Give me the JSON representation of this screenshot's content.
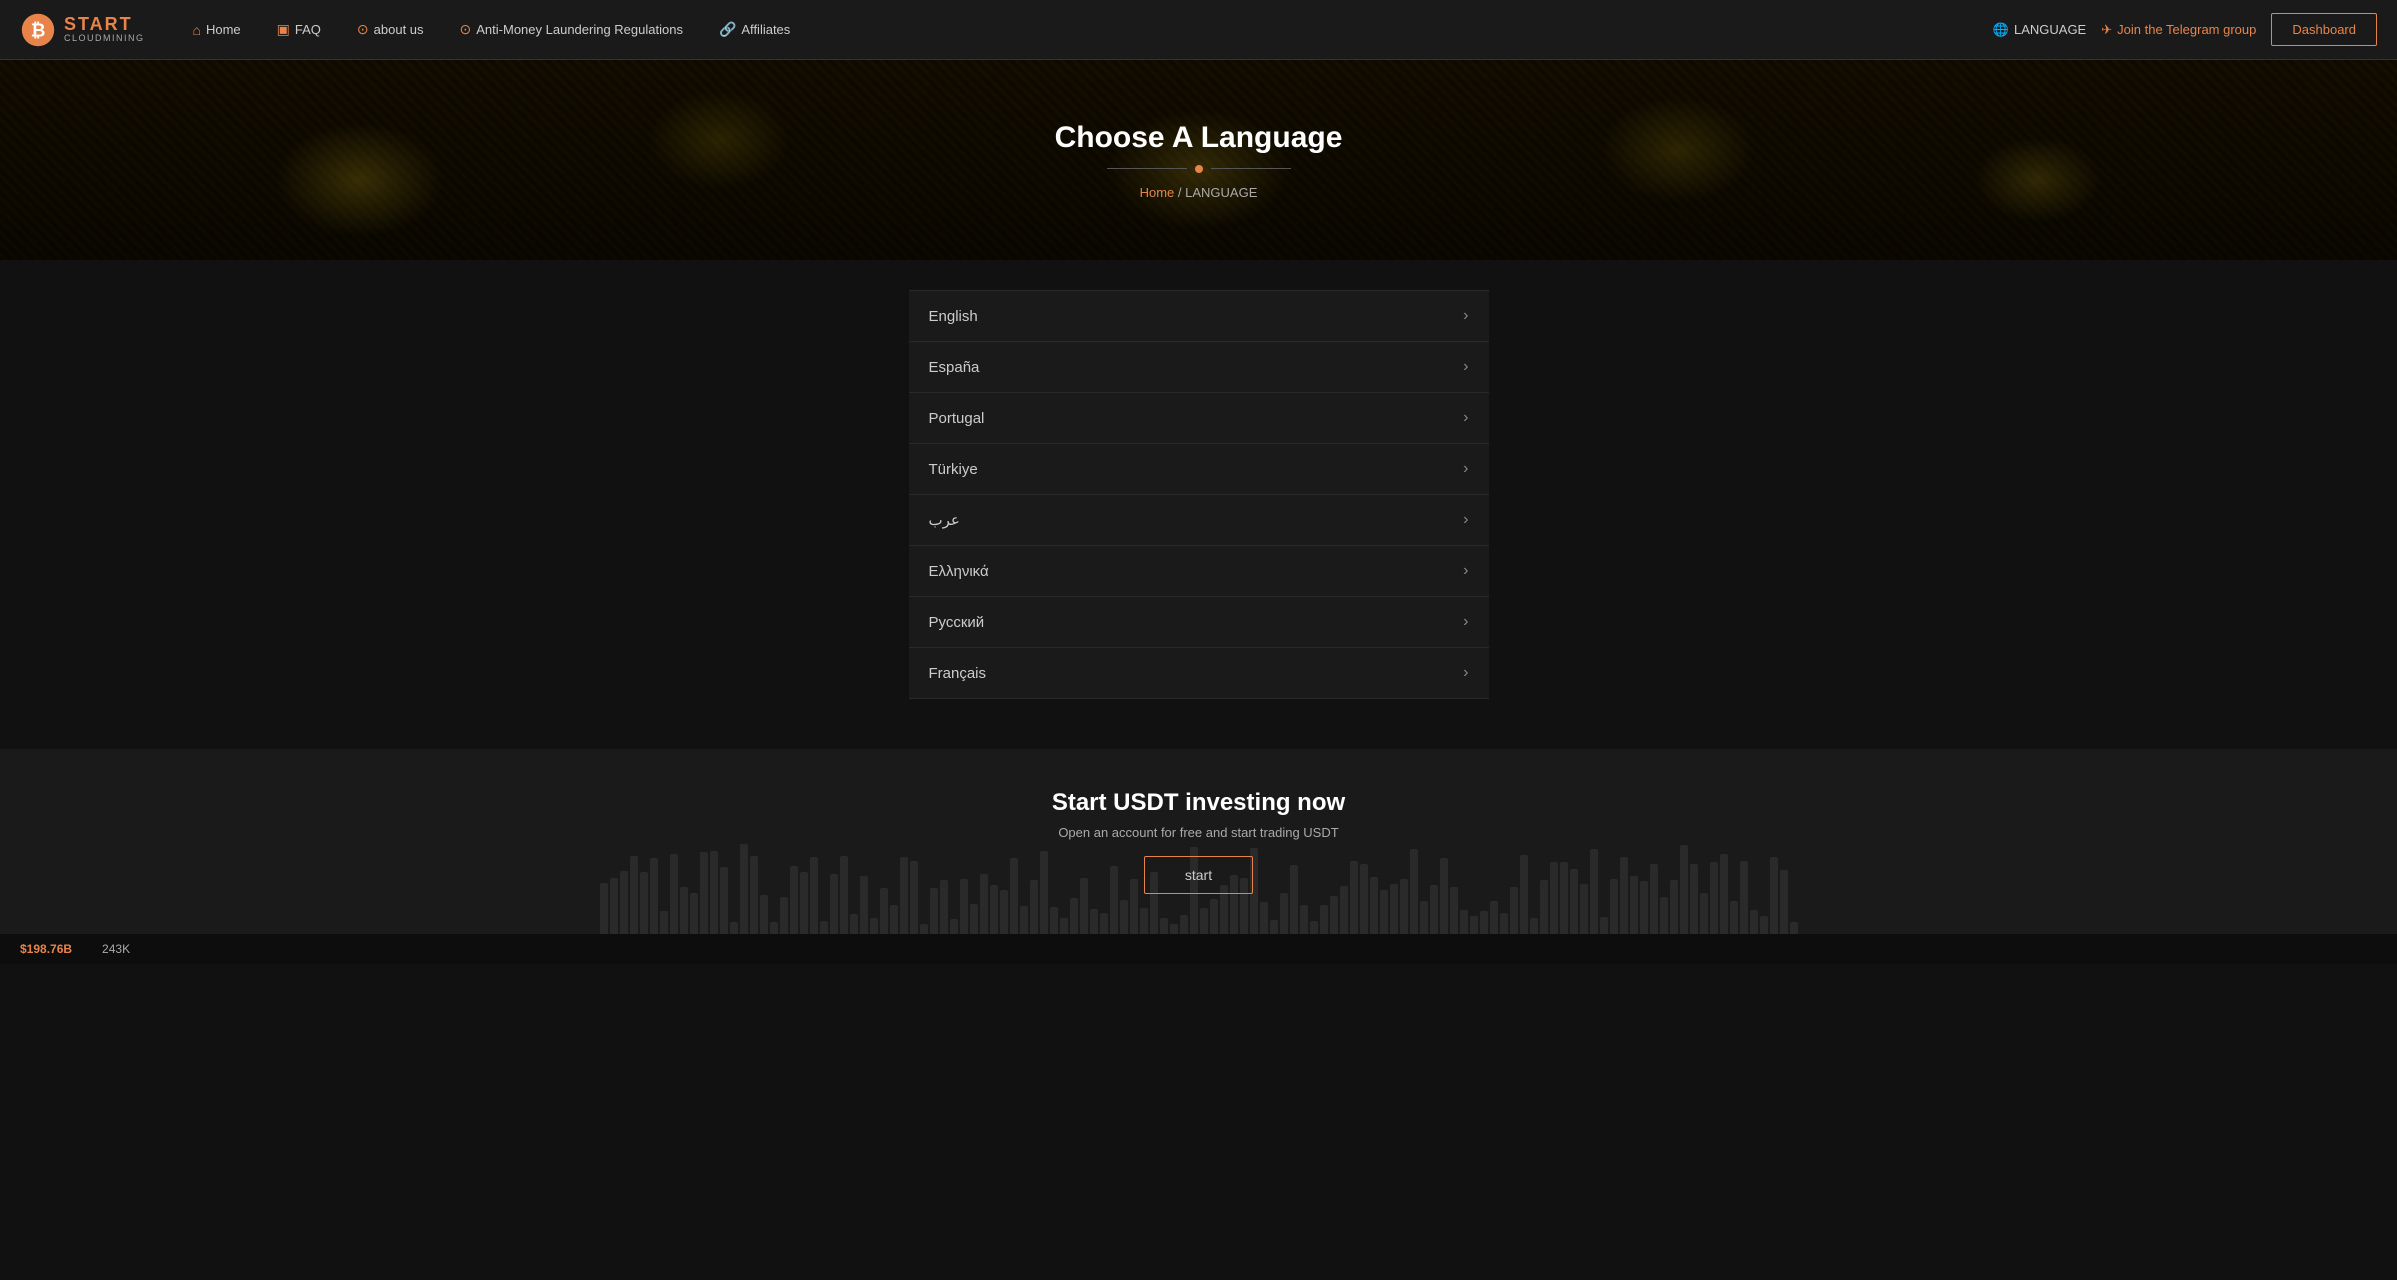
{
  "logo": {
    "start": "START",
    "cloud": "CLOUDMINING"
  },
  "nav": {
    "home": "Home",
    "faq": "FAQ",
    "about": "about us",
    "aml": "Anti-Money Laundering Regulations",
    "affiliates": "Affiliates",
    "language": "LANGUAGE",
    "telegram": "Join the Telegram group",
    "dashboard": "Dashboard"
  },
  "hero": {
    "title": "Choose A Language",
    "breadcrumb_home": "Home",
    "breadcrumb_separator": "/",
    "breadcrumb_current": "LANGUAGE"
  },
  "languages": [
    {
      "label": "English"
    },
    {
      "label": "España"
    },
    {
      "label": "Portugal"
    },
    {
      "label": "Türkiye"
    },
    {
      "label": "عرب"
    },
    {
      "label": "Ελληνικά"
    },
    {
      "label": "Русский"
    },
    {
      "label": "Français"
    }
  ],
  "footer": {
    "title": "Start USDT investing now",
    "subtitle": "Open an account for free and start trading USDT",
    "button": "start"
  },
  "ticker": {
    "price": "$198.76B",
    "val": "243K"
  }
}
